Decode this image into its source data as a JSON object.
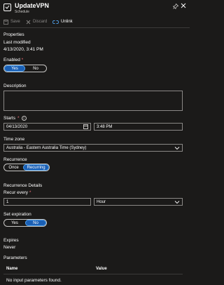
{
  "header": {
    "title": "UpdateVPN",
    "subtitle": "Schedule"
  },
  "toolbar": {
    "save_label": "Save",
    "discard_label": "Discard",
    "unlink_label": "Unlink"
  },
  "properties": {
    "heading": "Properties",
    "last_modified_label": "Last modified",
    "last_modified_value": "4/13/2020, 3:41 PM"
  },
  "enabled": {
    "label": "Enabled",
    "required_mark": "*",
    "yes_label": "Yes",
    "no_label": "No",
    "selected": "Yes"
  },
  "description": {
    "label": "Description",
    "value": ""
  },
  "starts": {
    "label": "Starts",
    "required_mark": "*",
    "info_glyph": "i",
    "date_value": "04/13/2020",
    "time_value": "3:48 PM"
  },
  "timezone": {
    "label": "Time zone",
    "value": "Australia - Eastern Australia Time (Sydney)"
  },
  "recurrence": {
    "label": "Recurrence",
    "once_label": "Once",
    "recurring_label": "Recurring",
    "selected": "Recurring"
  },
  "recurrence_details": {
    "heading": "Recurrence Details",
    "recur_every_label": "Recur every",
    "required_mark": "*",
    "interval_value": "1",
    "unit_value": "Hour"
  },
  "set_expiration": {
    "label": "Set expiration",
    "yes_label": "Yes",
    "no_label": "No",
    "selected": "No"
  },
  "expires": {
    "label": "Expires",
    "value": "Never"
  },
  "parameters": {
    "heading": "Parameters",
    "col_name": "Name",
    "col_value": "Value",
    "empty_message": "No input parameters found."
  },
  "colors": {
    "background": "#1b1a19",
    "accent": "#1a5fb4",
    "required": "#f1707b"
  }
}
